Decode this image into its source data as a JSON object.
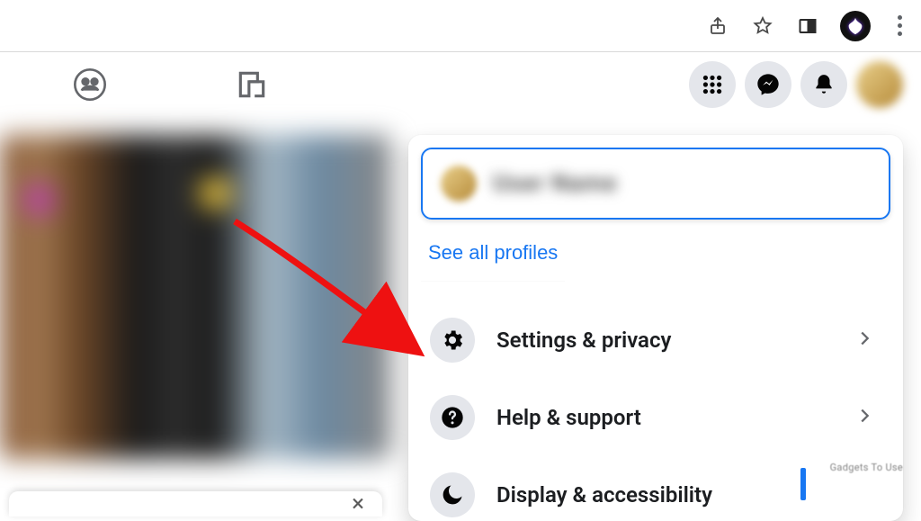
{
  "chrome": {
    "icons": {
      "share": "share-icon",
      "star": "star-icon",
      "panel": "side-panel-icon",
      "menu": "overflow-menu-icon"
    }
  },
  "nav": {
    "tabs": {
      "groups": "groups-icon",
      "gaming": "gaming-icon"
    },
    "right": {
      "menu": "menu-grid-icon",
      "messenger": "messenger-icon",
      "notifications": "bell-icon"
    }
  },
  "menu": {
    "profile_name": "User Name",
    "see_all_label": "See all profiles",
    "items": [
      {
        "icon": "gear-icon",
        "label": "Settings & privacy"
      },
      {
        "icon": "help-icon",
        "label": "Help & support"
      },
      {
        "icon": "moon-icon",
        "label": "Display & accessibility"
      }
    ]
  },
  "misc": {
    "close_symbol": "×",
    "watermark": "Gadgets To Use"
  }
}
